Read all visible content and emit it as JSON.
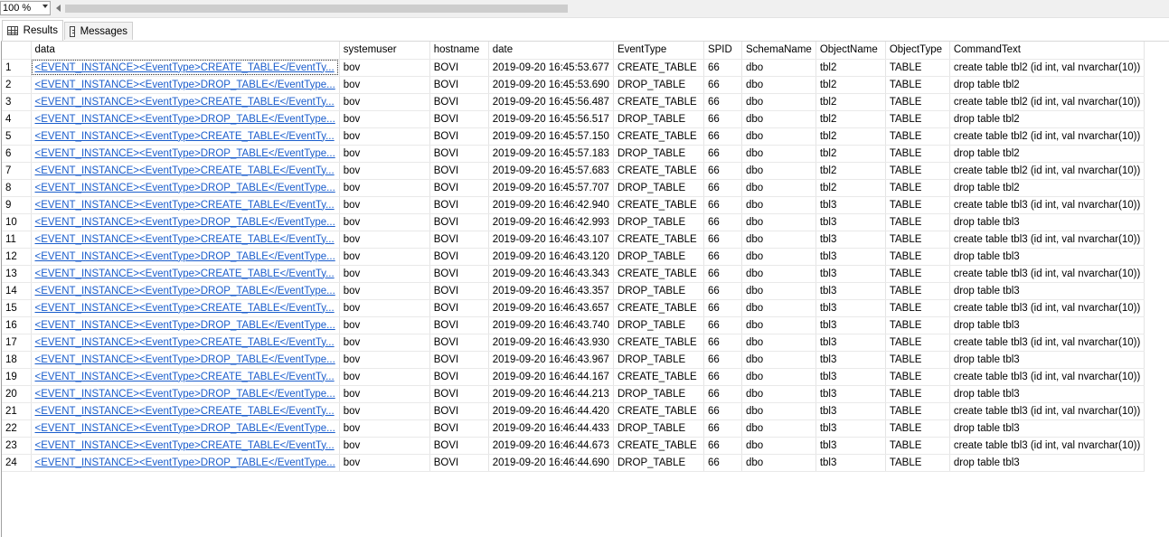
{
  "toolbar": {
    "zoom": "100 %"
  },
  "tabs": [
    {
      "label": "Results",
      "icon": "grid-icon",
      "active": true
    },
    {
      "label": "Messages",
      "icon": "messages-icon",
      "active": false
    }
  ],
  "columns": [
    "data",
    "systemuser",
    "hostname",
    "date",
    "EventType",
    "SPID",
    "SchemaName",
    "ObjectName",
    "ObjectType",
    "CommandText"
  ],
  "rows": [
    [
      "1",
      "<EVENT_INSTANCE><EventType>CREATE_TABLE</EventTy...",
      "bov",
      "BOVI",
      "2019-09-20 16:45:53.677",
      "CREATE_TABLE",
      "66",
      "dbo",
      "tbl2",
      "TABLE",
      "create table tbl2 (id int, val nvarchar(10))"
    ],
    [
      "2",
      "<EVENT_INSTANCE><EventType>DROP_TABLE</EventType...",
      "bov",
      "BOVI",
      "2019-09-20 16:45:53.690",
      "DROP_TABLE",
      "66",
      "dbo",
      "tbl2",
      "TABLE",
      "drop table tbl2"
    ],
    [
      "3",
      "<EVENT_INSTANCE><EventType>CREATE_TABLE</EventTy...",
      "bov",
      "BOVI",
      "2019-09-20 16:45:56.487",
      "CREATE_TABLE",
      "66",
      "dbo",
      "tbl2",
      "TABLE",
      "create table tbl2 (id int, val nvarchar(10))"
    ],
    [
      "4",
      "<EVENT_INSTANCE><EventType>DROP_TABLE</EventType...",
      "bov",
      "BOVI",
      "2019-09-20 16:45:56.517",
      "DROP_TABLE",
      "66",
      "dbo",
      "tbl2",
      "TABLE",
      "drop table tbl2"
    ],
    [
      "5",
      "<EVENT_INSTANCE><EventType>CREATE_TABLE</EventTy...",
      "bov",
      "BOVI",
      "2019-09-20 16:45:57.150",
      "CREATE_TABLE",
      "66",
      "dbo",
      "tbl2",
      "TABLE",
      "create table tbl2 (id int, val nvarchar(10))"
    ],
    [
      "6",
      "<EVENT_INSTANCE><EventType>DROP_TABLE</EventType...",
      "bov",
      "BOVI",
      "2019-09-20 16:45:57.183",
      "DROP_TABLE",
      "66",
      "dbo",
      "tbl2",
      "TABLE",
      "drop table tbl2"
    ],
    [
      "7",
      "<EVENT_INSTANCE><EventType>CREATE_TABLE</EventTy...",
      "bov",
      "BOVI",
      "2019-09-20 16:45:57.683",
      "CREATE_TABLE",
      "66",
      "dbo",
      "tbl2",
      "TABLE",
      "create table tbl2 (id int, val nvarchar(10))"
    ],
    [
      "8",
      "<EVENT_INSTANCE><EventType>DROP_TABLE</EventType...",
      "bov",
      "BOVI",
      "2019-09-20 16:45:57.707",
      "DROP_TABLE",
      "66",
      "dbo",
      "tbl2",
      "TABLE",
      "drop table tbl2"
    ],
    [
      "9",
      "<EVENT_INSTANCE><EventType>CREATE_TABLE</EventTy...",
      "bov",
      "BOVI",
      "2019-09-20 16:46:42.940",
      "CREATE_TABLE",
      "66",
      "dbo",
      "tbl3",
      "TABLE",
      "create table tbl3 (id int, val nvarchar(10))"
    ],
    [
      "10",
      "<EVENT_INSTANCE><EventType>DROP_TABLE</EventType...",
      "bov",
      "BOVI",
      "2019-09-20 16:46:42.993",
      "DROP_TABLE",
      "66",
      "dbo",
      "tbl3",
      "TABLE",
      "drop table tbl3"
    ],
    [
      "11",
      "<EVENT_INSTANCE><EventType>CREATE_TABLE</EventTy...",
      "bov",
      "BOVI",
      "2019-09-20 16:46:43.107",
      "CREATE_TABLE",
      "66",
      "dbo",
      "tbl3",
      "TABLE",
      "create table tbl3 (id int, val nvarchar(10))"
    ],
    [
      "12",
      "<EVENT_INSTANCE><EventType>DROP_TABLE</EventType...",
      "bov",
      "BOVI",
      "2019-09-20 16:46:43.120",
      "DROP_TABLE",
      "66",
      "dbo",
      "tbl3",
      "TABLE",
      "drop table tbl3"
    ],
    [
      "13",
      "<EVENT_INSTANCE><EventType>CREATE_TABLE</EventTy...",
      "bov",
      "BOVI",
      "2019-09-20 16:46:43.343",
      "CREATE_TABLE",
      "66",
      "dbo",
      "tbl3",
      "TABLE",
      "create table tbl3 (id int, val nvarchar(10))"
    ],
    [
      "14",
      "<EVENT_INSTANCE><EventType>DROP_TABLE</EventType...",
      "bov",
      "BOVI",
      "2019-09-20 16:46:43.357",
      "DROP_TABLE",
      "66",
      "dbo",
      "tbl3",
      "TABLE",
      "drop table tbl3"
    ],
    [
      "15",
      "<EVENT_INSTANCE><EventType>CREATE_TABLE</EventTy...",
      "bov",
      "BOVI",
      "2019-09-20 16:46:43.657",
      "CREATE_TABLE",
      "66",
      "dbo",
      "tbl3",
      "TABLE",
      "create table tbl3 (id int, val nvarchar(10))"
    ],
    [
      "16",
      "<EVENT_INSTANCE><EventType>DROP_TABLE</EventType...",
      "bov",
      "BOVI",
      "2019-09-20 16:46:43.740",
      "DROP_TABLE",
      "66",
      "dbo",
      "tbl3",
      "TABLE",
      "drop table tbl3"
    ],
    [
      "17",
      "<EVENT_INSTANCE><EventType>CREATE_TABLE</EventTy...",
      "bov",
      "BOVI",
      "2019-09-20 16:46:43.930",
      "CREATE_TABLE",
      "66",
      "dbo",
      "tbl3",
      "TABLE",
      "create table tbl3 (id int, val nvarchar(10))"
    ],
    [
      "18",
      "<EVENT_INSTANCE><EventType>DROP_TABLE</EventType...",
      "bov",
      "BOVI",
      "2019-09-20 16:46:43.967",
      "DROP_TABLE",
      "66",
      "dbo",
      "tbl3",
      "TABLE",
      "drop table tbl3"
    ],
    [
      "19",
      "<EVENT_INSTANCE><EventType>CREATE_TABLE</EventTy...",
      "bov",
      "BOVI",
      "2019-09-20 16:46:44.167",
      "CREATE_TABLE",
      "66",
      "dbo",
      "tbl3",
      "TABLE",
      "create table tbl3 (id int, val nvarchar(10))"
    ],
    [
      "20",
      "<EVENT_INSTANCE><EventType>DROP_TABLE</EventType...",
      "bov",
      "BOVI",
      "2019-09-20 16:46:44.213",
      "DROP_TABLE",
      "66",
      "dbo",
      "tbl3",
      "TABLE",
      "drop table tbl3"
    ],
    [
      "21",
      "<EVENT_INSTANCE><EventType>CREATE_TABLE</EventTy...",
      "bov",
      "BOVI",
      "2019-09-20 16:46:44.420",
      "CREATE_TABLE",
      "66",
      "dbo",
      "tbl3",
      "TABLE",
      "create table tbl3 (id int, val nvarchar(10))"
    ],
    [
      "22",
      "<EVENT_INSTANCE><EventType>DROP_TABLE</EventType...",
      "bov",
      "BOVI",
      "2019-09-20 16:46:44.433",
      "DROP_TABLE",
      "66",
      "dbo",
      "tbl3",
      "TABLE",
      "drop table tbl3"
    ],
    [
      "23",
      "<EVENT_INSTANCE><EventType>CREATE_TABLE</EventTy...",
      "bov",
      "BOVI",
      "2019-09-20 16:46:44.673",
      "CREATE_TABLE",
      "66",
      "dbo",
      "tbl3",
      "TABLE",
      "create table tbl3 (id int, val nvarchar(10))"
    ],
    [
      "24",
      "<EVENT_INSTANCE><EventType>DROP_TABLE</EventType...",
      "bov",
      "BOVI",
      "2019-09-20 16:46:44.690",
      "DROP_TABLE",
      "66",
      "dbo",
      "tbl3",
      "TABLE",
      "drop table tbl3"
    ]
  ],
  "colors": {
    "link": "#1a5dcc",
    "grid_line": "#e4e4e4",
    "toolbar_bg": "#f0f0f0"
  }
}
